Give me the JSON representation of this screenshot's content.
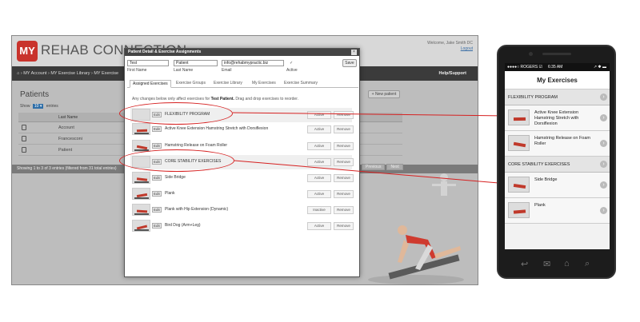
{
  "desktop": {
    "logo_badge": "MY",
    "logo_text": "REHAB CONNECTION",
    "welcome": "Welcome, Jake Smith DC",
    "logout": "Logout",
    "breadcrumb": "⌂ › MY Account › MY Exercise Library › MY Exercise",
    "help_support": "Help/Support",
    "patients_heading": "Patients",
    "new_patient_label": "+ New patient",
    "show_label": "Show",
    "show_value": "10 ▾",
    "entries_label": "entries",
    "last_name_header": "Last Name",
    "patients": [
      "Account",
      "Francesconi",
      "Patient"
    ],
    "footer_text": "Showing 1 to 3 of 3 entries (filtered from 31 total entries)",
    "pager": [
      "Previous",
      "Next"
    ]
  },
  "modal": {
    "title": "Patient Detail & Exercise Assignments",
    "close": "×",
    "first_name_value": "Test",
    "last_name_value": "Patient",
    "email_value": "info@rehabmypractic.biz",
    "active_value": "✓",
    "first_name_label": "First Name",
    "last_name_label": "Last Name",
    "email_label": "Email",
    "active_label": "Active",
    "save_label": "Save",
    "tabs": [
      "Assigned Exercises",
      "Exercise Groups",
      "Exercise Library",
      "My Exercises",
      "Exercise Summary"
    ],
    "note_pre": "Any changes below only affect exercises for ",
    "note_bold": "Test Patient.",
    "note_post": " Drag and drop exercises to reorder.",
    "edit_label": "Edit",
    "rows": [
      {
        "name": "FLEXIBILITY PROGRAM",
        "status": "Active",
        "remove": "Remove",
        "header": true
      },
      {
        "name": "Active Knee Extension Hamstring Stretch with Dorsiflexion",
        "status": "Active",
        "remove": "Remove",
        "header": false
      },
      {
        "name": "Hamstring Release on Foam Roller",
        "status": "Active",
        "remove": "Remove",
        "header": false
      },
      {
        "name": "CORE STABILITY EXERCISES",
        "status": "Active",
        "remove": "Remove",
        "header": true
      },
      {
        "name": "Side Bridge",
        "status": "Active",
        "remove": "Remove",
        "header": false
      },
      {
        "name": "Plank",
        "status": "Active",
        "remove": "Remove",
        "header": false
      },
      {
        "name": "Plank with Hip Extension (Dynamic)",
        "status": "Inactive",
        "remove": "Remove",
        "header": false
      },
      {
        "name": "Bird Dog (Arm+Leg)",
        "status": "Active",
        "remove": "Remove",
        "header": false
      }
    ]
  },
  "phone": {
    "carrier": "●●●●○ ROGERS ☑",
    "time": "6:35 AM",
    "battery": "↗ ✱ ▬",
    "title": "My Exercises",
    "items": [
      {
        "type": "section",
        "label": "FLEXIBILITY PROGRAM"
      },
      {
        "type": "item",
        "label": "Active Knee Extension Hamstring Stretch with Dorsiflexion"
      },
      {
        "type": "item",
        "label": "Hamstring Release on Foam Roller"
      },
      {
        "type": "section",
        "label": "CORE STABILITY EXERCISES"
      },
      {
        "type": "item",
        "label": "Side Bridge"
      },
      {
        "type": "item",
        "label": "Plank"
      }
    ],
    "chevron": "›"
  },
  "colors": {
    "accent": "#c9332c",
    "annotation": "#d62020",
    "nav_dark": "#3b3b3b"
  }
}
